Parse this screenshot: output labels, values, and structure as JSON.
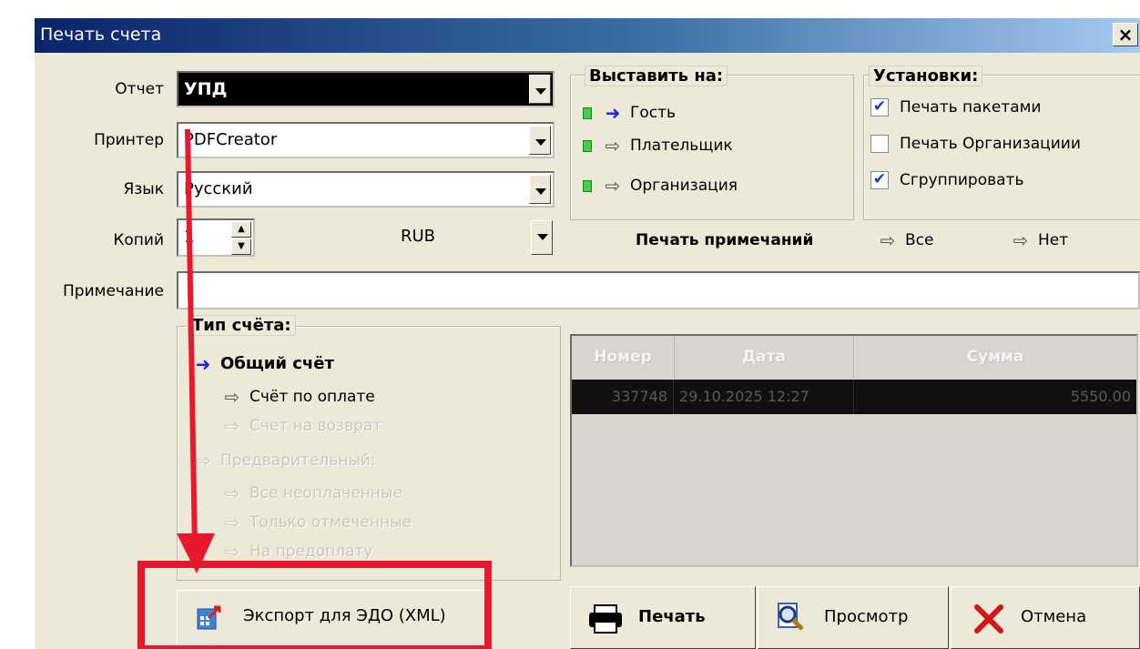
{
  "window": {
    "title": "Печать счета",
    "close": "×"
  },
  "fields": {
    "report_label": "Отчет",
    "report_value": "УПД",
    "printer_label": "Принтер",
    "printer_value": "PDFCreator",
    "language_label": "Язык",
    "language_value": "Русский",
    "copies_label": "Копий",
    "copies_value": "1",
    "currency_value": "RUB",
    "note_label": "Примечание",
    "note_value": ""
  },
  "bill_to": {
    "title": "Выставить на:",
    "options": [
      "Гость",
      "Плательщик",
      "Организация"
    ],
    "selected": "Гость"
  },
  "settings": {
    "title": "Установки:",
    "items": [
      {
        "label": "Печать пакетами",
        "checked": true
      },
      {
        "label": "Печать Организациии",
        "checked": false
      },
      {
        "label": "Сгруппировать",
        "checked": true
      }
    ]
  },
  "notes_print": {
    "label": "Печать примечаний",
    "all": "Все",
    "none": "Нет"
  },
  "bill_type": {
    "title": "Тип счёта:",
    "general": "Общий счёт",
    "payment": "Счёт по оплате",
    "refund": "Счет на возврат",
    "preliminary": "Предварительный:",
    "all_unpaid": "Все неоплаченные",
    "only_marked": "Только отмеченные",
    "prepayment": "На предоплату"
  },
  "table": {
    "headers": [
      "Номер",
      "Дата",
      "Сумма"
    ],
    "rows": [
      [
        "337748",
        "29.10.2025 12:27",
        "5550.00"
      ]
    ]
  },
  "buttons": {
    "export": "Экспорт для ЭДО (XML)",
    "print": "Печать",
    "preview": "Просмотр",
    "cancel": "Отмена"
  },
  "colors": {
    "annotation": "#e8192c",
    "title_start": "#0a246a",
    "title_end": "#a6caf0"
  }
}
